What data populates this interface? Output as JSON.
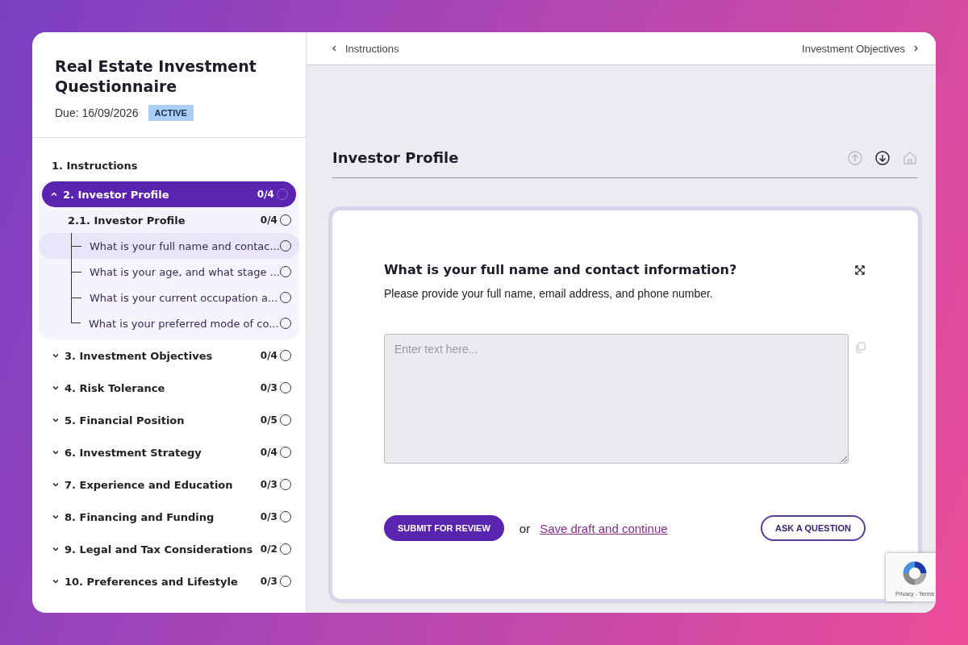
{
  "sidebar": {
    "title": "Real Estate Investment Questionnaire",
    "due": "Due: 16/09/2026",
    "status": "ACTIVE",
    "sections": [
      {
        "label": "1. Instructions",
        "selected": false
      },
      {
        "label": "2. Investor Profile",
        "count": "0/4",
        "expanded": true,
        "selected": true,
        "children": [
          {
            "label": "2.1. Investor Profile",
            "count": "0/4",
            "children": [
              {
                "label": "What is your full name and contac...",
                "selected": true
              },
              {
                "label": "What is your age, and what stage ...",
                "selected": false
              },
              {
                "label": "What is your current occupation a...",
                "selected": false
              },
              {
                "label": "What is your preferred mode of co...",
                "selected": false
              }
            ]
          }
        ]
      },
      {
        "label": "3. Investment Objectives",
        "count": "0/4",
        "expanded": false,
        "selected": false
      },
      {
        "label": "4. Risk Tolerance",
        "count": "0/3",
        "expanded": false,
        "selected": false
      },
      {
        "label": "5. Financial Position",
        "count": "0/5",
        "expanded": false,
        "selected": false
      },
      {
        "label": "6. Investment Strategy",
        "count": "0/4",
        "expanded": false,
        "selected": false
      },
      {
        "label": "7. Experience and Education",
        "count": "0/3",
        "expanded": false,
        "selected": false
      },
      {
        "label": "8. Financing and Funding",
        "count": "0/3",
        "expanded": false,
        "selected": false
      },
      {
        "label": "9. Legal and Tax Considerations",
        "count": "0/2",
        "expanded": false,
        "selected": false
      },
      {
        "label": "10. Preferences and Lifestyle",
        "count": "0/3",
        "expanded": false,
        "selected": false
      }
    ]
  },
  "nav": {
    "previous": "Instructions",
    "next": "Investment Objectives"
  },
  "section_title": "Investor Profile",
  "question": {
    "title": "What is your full name and contact information?",
    "description": "Please provide your full name, email address, and phone number.",
    "placeholder": "Enter text here...",
    "submit": "SUBMIT FOR REVIEW",
    "or": "or",
    "save_link": "Save draft and continue",
    "ask": "ASK A QUESTION"
  },
  "recaptcha": {
    "text": "Privacy - Terms"
  }
}
